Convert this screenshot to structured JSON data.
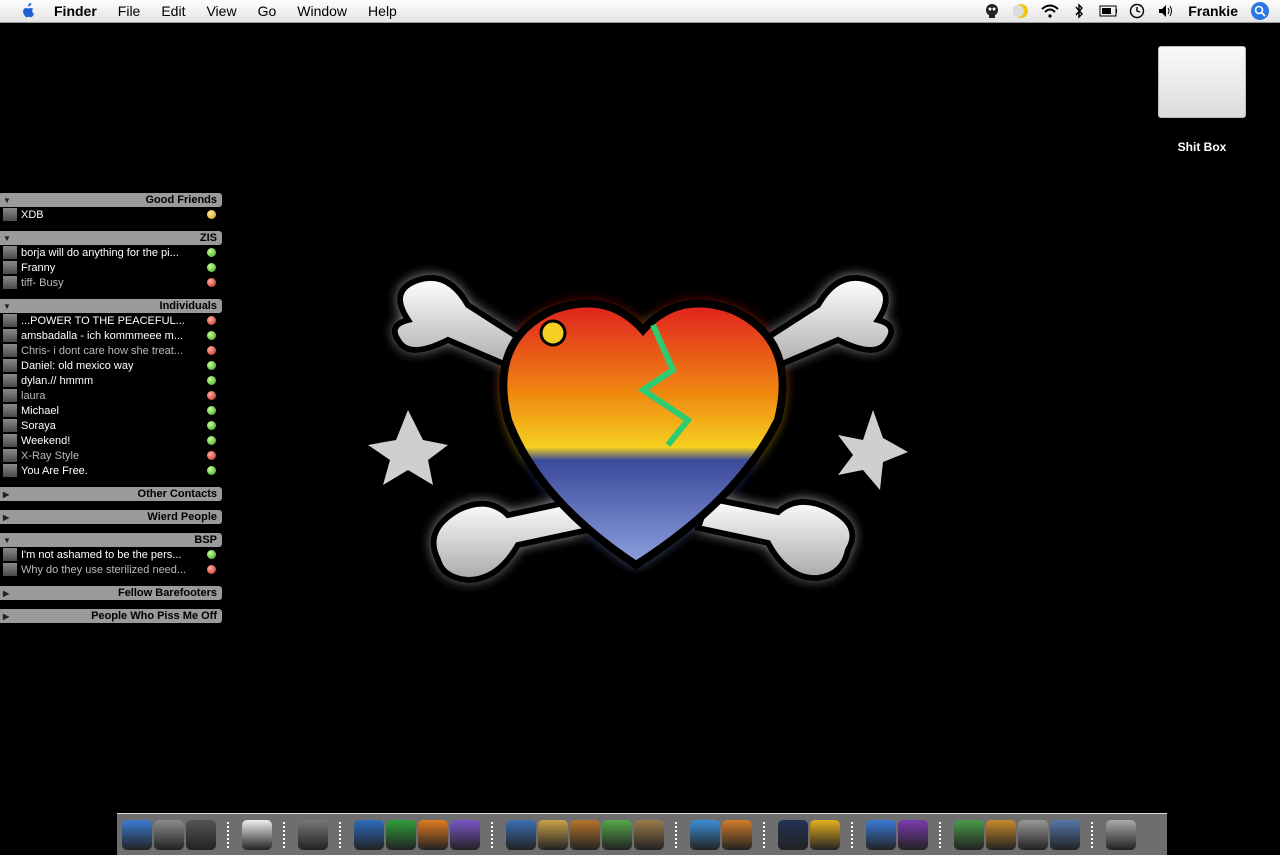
{
  "menubar": {
    "app_name": "Finder",
    "items": [
      "File",
      "Edit",
      "View",
      "Go",
      "Window",
      "Help"
    ],
    "user": "Frankie"
  },
  "desktop": {
    "drive_label": "Shit Box"
  },
  "buddy_list": {
    "groups": [
      {
        "name": "Good Friends",
        "expanded": true,
        "buddies": [
          {
            "name": "XDB",
            "status": "yellow",
            "away": false
          }
        ]
      },
      {
        "name": "ZIS",
        "expanded": true,
        "buddies": [
          {
            "name": "borja will do anything for the pi...",
            "status": "green",
            "away": false
          },
          {
            "name": "Franny",
            "status": "green",
            "away": false
          },
          {
            "name": "tiff-  Busy",
            "status": "red",
            "away": true
          }
        ]
      },
      {
        "name": "Individuals",
        "expanded": true,
        "buddies": [
          {
            "name": "...POWER TO THE PEACEFUL...",
            "status": "red",
            "away": false
          },
          {
            "name": "amsbadalla - ich kommmeee m...",
            "status": "green",
            "away": false
          },
          {
            "name": "Chris- i dont care how she treat...",
            "status": "red",
            "away": true
          },
          {
            "name": "Daniel: old mexico way",
            "status": "green",
            "away": false
          },
          {
            "name": "dylan.// hmmm",
            "status": "green",
            "away": false
          },
          {
            "name": "laura",
            "status": "red",
            "away": true
          },
          {
            "name": "Michael",
            "status": "green",
            "away": false
          },
          {
            "name": "Soraya",
            "status": "green",
            "away": false
          },
          {
            "name": "Weekend!",
            "status": "green",
            "away": false
          },
          {
            "name": "X-Ray Style",
            "status": "red",
            "away": true
          },
          {
            "name": "You Are Free.",
            "status": "green",
            "away": false
          }
        ]
      },
      {
        "name": "Other Contacts",
        "expanded": false,
        "buddies": []
      },
      {
        "name": "Wierd People",
        "expanded": false,
        "buddies": []
      },
      {
        "name": "BSP",
        "expanded": true,
        "buddies": [
          {
            "name": "I'm not ashamed to be the pers...",
            "status": "green",
            "away": false
          },
          {
            "name": "Why do they use sterilized need...",
            "status": "red",
            "away": true
          }
        ]
      },
      {
        "name": "Fellow Barefooters",
        "expanded": false,
        "buddies": []
      },
      {
        "name": "People Who Piss Me Off",
        "expanded": false,
        "buddies": []
      }
    ]
  },
  "dock": {
    "icons": [
      {
        "name": "finder-icon",
        "color": "#3a7bd5"
      },
      {
        "name": "dashboard-icon",
        "color": "#8a8a8a"
      },
      {
        "name": "system-preferences-icon",
        "color": "#555555"
      },
      {
        "sep": true
      },
      {
        "name": "ipod-icon",
        "color": "#eeeeee"
      },
      {
        "sep": true
      },
      {
        "name": "clapper-icon",
        "color": "#777777"
      },
      {
        "sep": true
      },
      {
        "name": "word-icon",
        "color": "#2d6cc0"
      },
      {
        "name": "excel-icon",
        "color": "#2e9e3a"
      },
      {
        "name": "powerpoint-icon",
        "color": "#e07a20"
      },
      {
        "name": "entourage-icon",
        "color": "#7a56c8"
      },
      {
        "sep": true
      },
      {
        "name": "mail-icon",
        "color": "#3a6fb5"
      },
      {
        "name": "address-book-icon",
        "color": "#c9a24a"
      },
      {
        "name": "garageband-icon",
        "color": "#b8742a"
      },
      {
        "name": "itunes-icon",
        "color": "#55a84a"
      },
      {
        "name": "iphoto-icon",
        "color": "#9a7b4a"
      },
      {
        "sep": true
      },
      {
        "name": "safari-icon",
        "color": "#3a8fd6"
      },
      {
        "name": "camino-icon",
        "color": "#d27d2a"
      },
      {
        "sep": true
      },
      {
        "name": "dark-app-icon",
        "color": "#223355"
      },
      {
        "name": "warning-sign-icon",
        "color": "#e6b020"
      },
      {
        "sep": true
      },
      {
        "name": "ichat-icon",
        "color": "#3a7ad6"
      },
      {
        "name": "adium-icon",
        "color": "#7a3ab0"
      },
      {
        "sep": true
      },
      {
        "name": "activity-monitor-icon",
        "color": "#4a9a4a"
      },
      {
        "name": "cocktail-icon",
        "color": "#c88a2a"
      },
      {
        "name": "preview-icon",
        "color": "#999999"
      },
      {
        "name": "image-capture-icon",
        "color": "#5577aa"
      },
      {
        "sep": true
      },
      {
        "name": "trash-icon",
        "color": "#aaaaaa"
      }
    ]
  }
}
